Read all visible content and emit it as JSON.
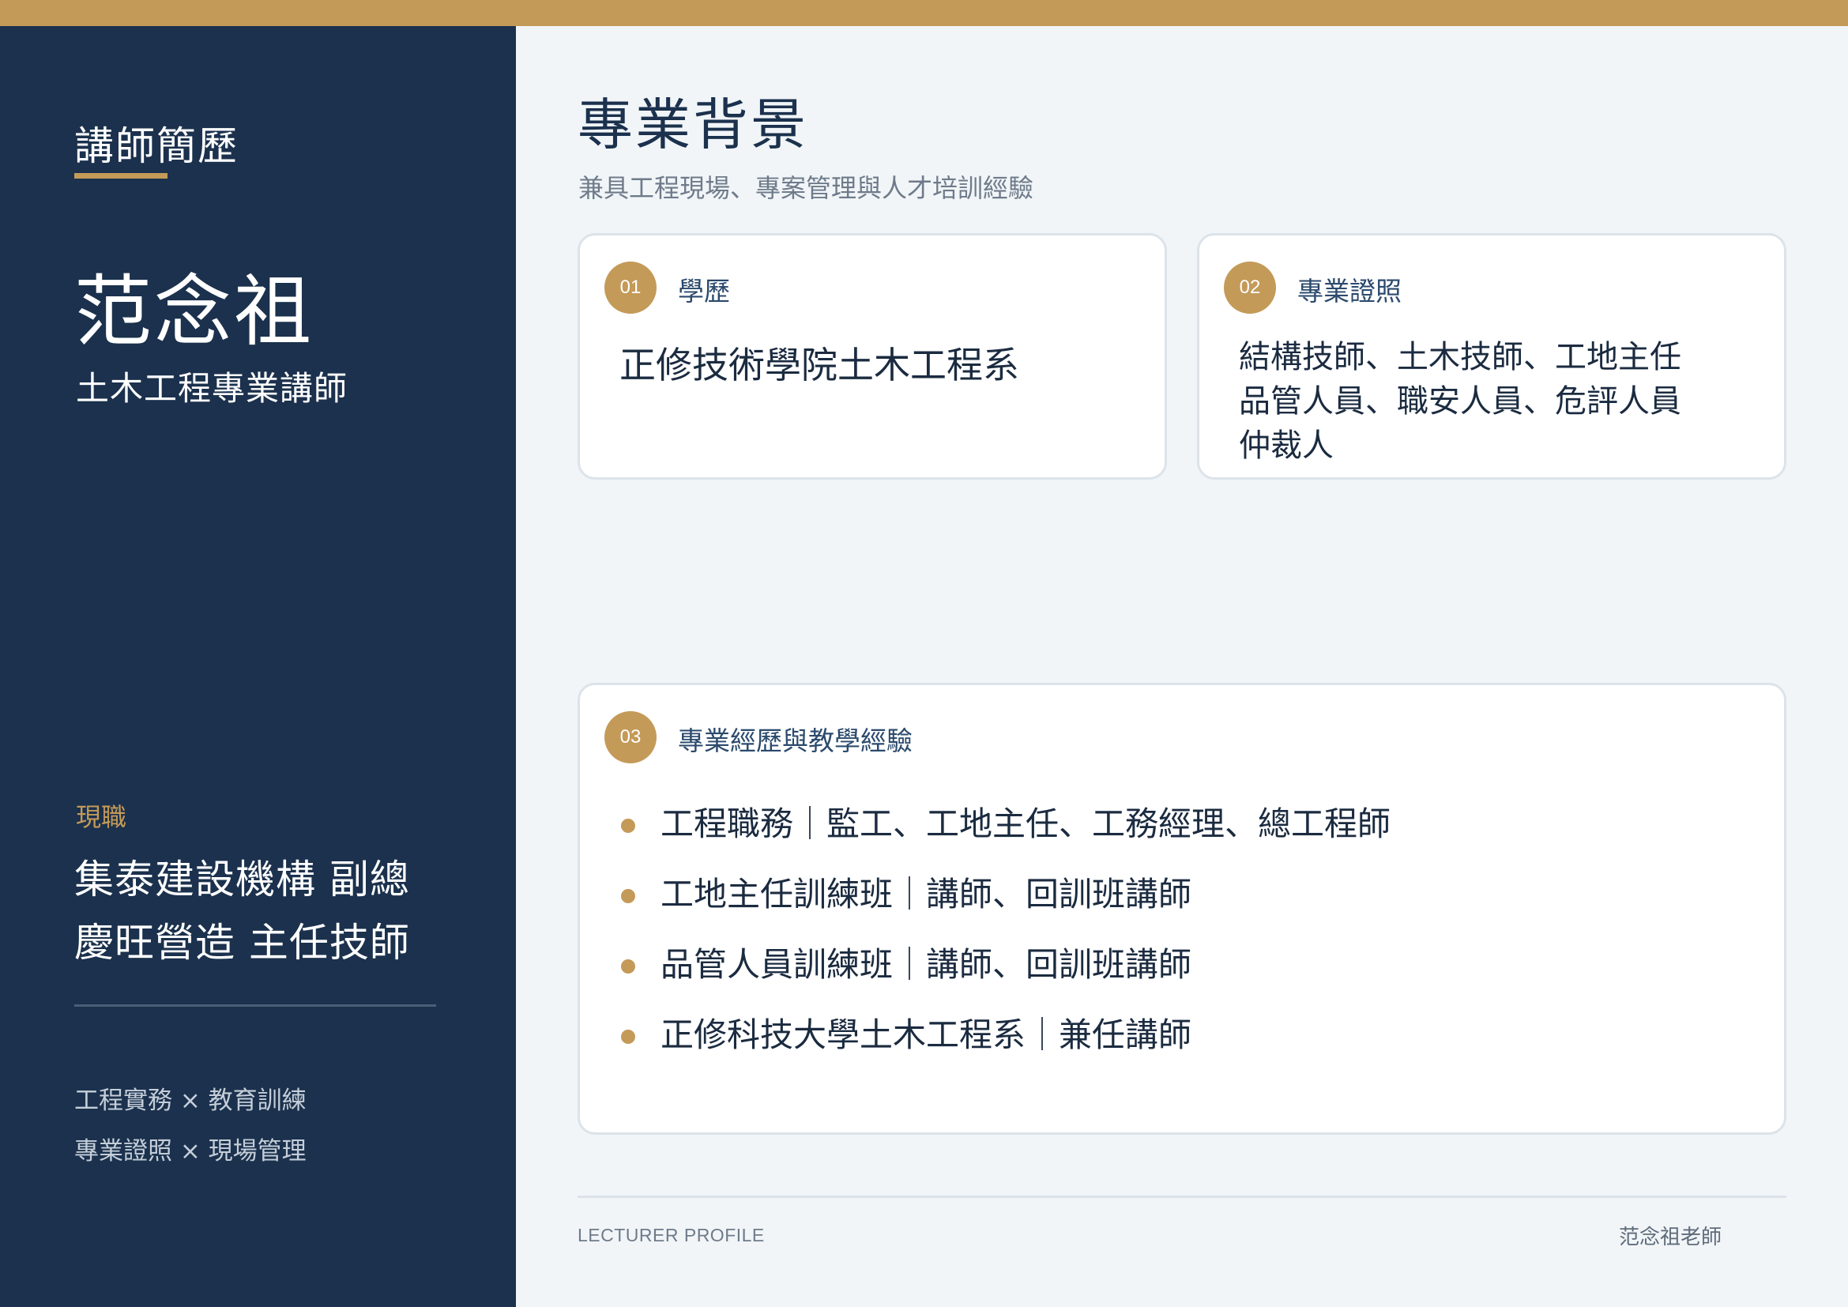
{
  "colors": {
    "accent": "#c49a58",
    "navy": "#1b314d",
    "background": "#f1f5f8",
    "card": "#ffffff"
  },
  "sidebar": {
    "header": "講師簡歷",
    "name": "范念祖",
    "title": "土木工程專業講師",
    "current_label": "現職",
    "current_positions": [
      "集泰建設機構 副總",
      "慶旺營造 主任技師"
    ],
    "tags": [
      "工程實務 × 教育訓練",
      "專業證照 × 現場管理"
    ]
  },
  "main": {
    "title": "專業背景",
    "subtitle": "兼具工程現場、專案管理與人才培訓經驗",
    "cards": [
      {
        "number": "01",
        "label": "學歷",
        "lines": [
          "正修技術學院土木工程系"
        ]
      },
      {
        "number": "02",
        "label": "專業證照",
        "lines": [
          "結構技師、土木技師、工地主任",
          "品管人員、職安人員、危評人員",
          "仲裁人"
        ]
      },
      {
        "number": "03",
        "label": "專業經歷與教學經驗",
        "items": [
          "工程職務｜監工、工地主任、工務經理、總工程師",
          "工地主任訓練班｜講師、回訓班講師",
          "品管人員訓練班｜講師、回訓班講師",
          "正修科技大學土木工程系｜兼任講師"
        ]
      }
    ]
  },
  "footer": {
    "left": "LECTURER PROFILE",
    "right": "范念祖老師"
  }
}
